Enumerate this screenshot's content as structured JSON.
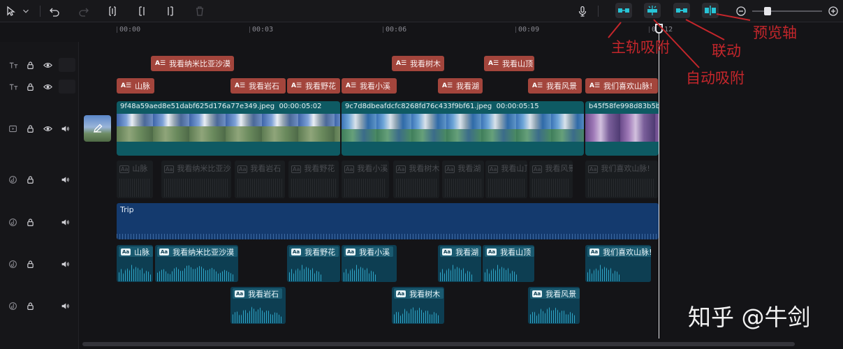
{
  "toolbar": {
    "icons": [
      "cursor-icon",
      "chevron-down-icon",
      "undo-icon",
      "redo-icon",
      "split-icon",
      "trim-left-icon",
      "trim-right-icon",
      "delete-icon",
      "microphone-icon",
      "main-track-snap-icon",
      "auto-snap-icon",
      "link-icon",
      "preview-axis-icon",
      "zoom-out-icon",
      "zoom-in-icon"
    ],
    "zoom_level": 0.2
  },
  "ruler": {
    "labels": [
      "00:00",
      "00:03",
      "00:06",
      "00:09",
      "00:12"
    ]
  },
  "tracks": {
    "text_row_1": [
      {
        "label": "我看纳米比亚沙漠"
      },
      {
        "label": "我看树木"
      },
      {
        "label": "我看山顶"
      }
    ],
    "text_row_2": [
      {
        "label": "山脉"
      },
      {
        "label": "我看岩石"
      },
      {
        "label": "我看野花"
      },
      {
        "label": "我看小溪"
      },
      {
        "label": "我看湖"
      },
      {
        "label": "我看风景"
      },
      {
        "label": "我们喜欢山脉!"
      }
    ],
    "video": [
      {
        "name": "9f48a59aed8e51dabf625d176a77e349.jpeg",
        "duration": "00:00:05:02"
      },
      {
        "name": "9c7d8dbeafdcfc8268fd76c433f9bf61.jpeg",
        "duration": "00:00:05:15"
      },
      {
        "name": "b45f58fe998d83b5b",
        "duration": ""
      }
    ],
    "ghost": [
      {
        "label": "山脉"
      },
      {
        "label": "我看纳米比亚沙漠"
      },
      {
        "label": "我看岩石"
      },
      {
        "label": "我看野花"
      },
      {
        "label": "我看小溪"
      },
      {
        "label": "我看树木"
      },
      {
        "label": "我看湖"
      },
      {
        "label": "我看山顶"
      },
      {
        "label": "我看风景"
      },
      {
        "label": "我们喜欢山脉!"
      }
    ],
    "music": {
      "name": "Trip"
    },
    "audio_row_1": [
      {
        "label": "山脉"
      },
      {
        "label": "我看纳米比亚沙漠"
      },
      {
        "label": "我看野花"
      },
      {
        "label": "我看小溪"
      },
      {
        "label": "我看湖"
      },
      {
        "label": "我看山顶"
      },
      {
        "label": "我们喜欢山脉!"
      }
    ],
    "audio_row_2": [
      {
        "label": "我看岩石"
      },
      {
        "label": "我看树木"
      },
      {
        "label": "我看风景"
      }
    ]
  },
  "annotations": {
    "main_track_snap": "主轨吸附",
    "link": "联动",
    "preview_axis": "预览轴",
    "auto_snap": "自动吸附"
  },
  "watermark": "知乎 @牛剑",
  "colors": {
    "text_clip": "#a3453c",
    "video_clip": "#0e5a63",
    "music_clip": "#143a6e",
    "audio_clip": "#0d3e52",
    "annotation": "#c4262b",
    "accent_cyan": "#27c4d6"
  }
}
